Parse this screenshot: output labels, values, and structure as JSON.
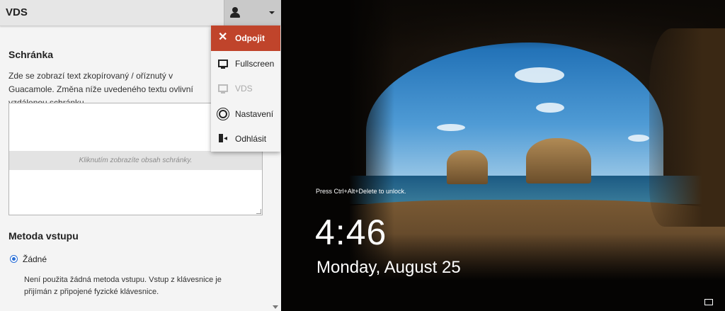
{
  "header": {
    "title": "VDS"
  },
  "menu": {
    "items": [
      {
        "label": "Odpojit",
        "icon": "close-icon"
      },
      {
        "label": "Fullscreen",
        "icon": "monitor-icon"
      },
      {
        "label": "VDS",
        "icon": "monitor-icon"
      },
      {
        "label": "Nastavení",
        "icon": "gear-icon"
      },
      {
        "label": "Odhlásit",
        "icon": "logout-icon"
      }
    ]
  },
  "clipboard": {
    "title": "Schránka",
    "description": "Zde se zobrazí text zkopírovaný / oříznutý v Guacamole. Změna níže uvedeného textu ovlivní vzdálenou schránku.",
    "hint": "Kliknutím zobrazíte obsah schránky."
  },
  "input_method": {
    "title": "Metoda vstupu",
    "options": [
      {
        "label": "Žádné",
        "selected": true,
        "description": "Není použita žádná metoda vstupu. Vstup z klávesnice je přijímán z připojené fyzické klávesnice."
      }
    ]
  },
  "lockscreen": {
    "hint": "Press Ctrl+Alt+Delete to unlock.",
    "time": "4:46",
    "date": "Monday, August 25"
  },
  "colors": {
    "danger": "#c0442b",
    "accent": "#2a6fd6"
  }
}
